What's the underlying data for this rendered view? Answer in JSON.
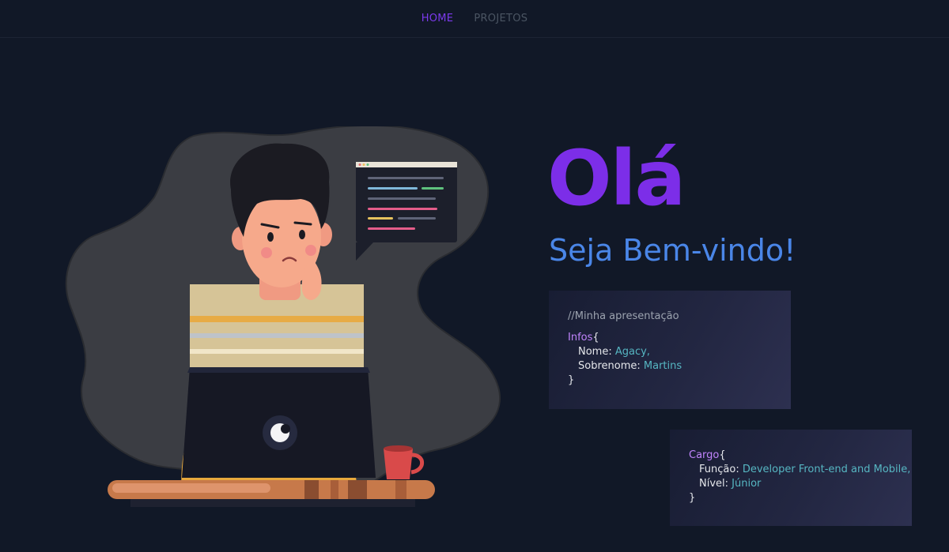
{
  "nav": {
    "home": "HOME",
    "projects": "PROJETOS"
  },
  "hero": {
    "greeting": "Olá",
    "welcome": "Seja Bem-vindo!"
  },
  "card_intro": {
    "comment": "//Minha apresentação",
    "object_name": "Infos",
    "open_brace": "{",
    "close_brace": "}",
    "name_key": "Nome: ",
    "name_value": "Agacy,",
    "surname_key": "Sobrenome: ",
    "surname_value": "Martins"
  },
  "card_job": {
    "object_name": "Cargo",
    "open_brace": "{",
    "close_brace": "}",
    "role_key": "Função: ",
    "role_value": "Developer Front-end and Mobile,",
    "level_key": "Nível: ",
    "level_value": "Júnior"
  },
  "colors": {
    "background": "#111827",
    "accent_purple": "#7c2ee8",
    "accent_blue": "#4a86e8",
    "code_value": "#56b6c2",
    "code_keyword": "#c084fc"
  },
  "icons": [
    "person-at-laptop-illustration",
    "code-speech-bubble",
    "coffee-mug-icon"
  ]
}
